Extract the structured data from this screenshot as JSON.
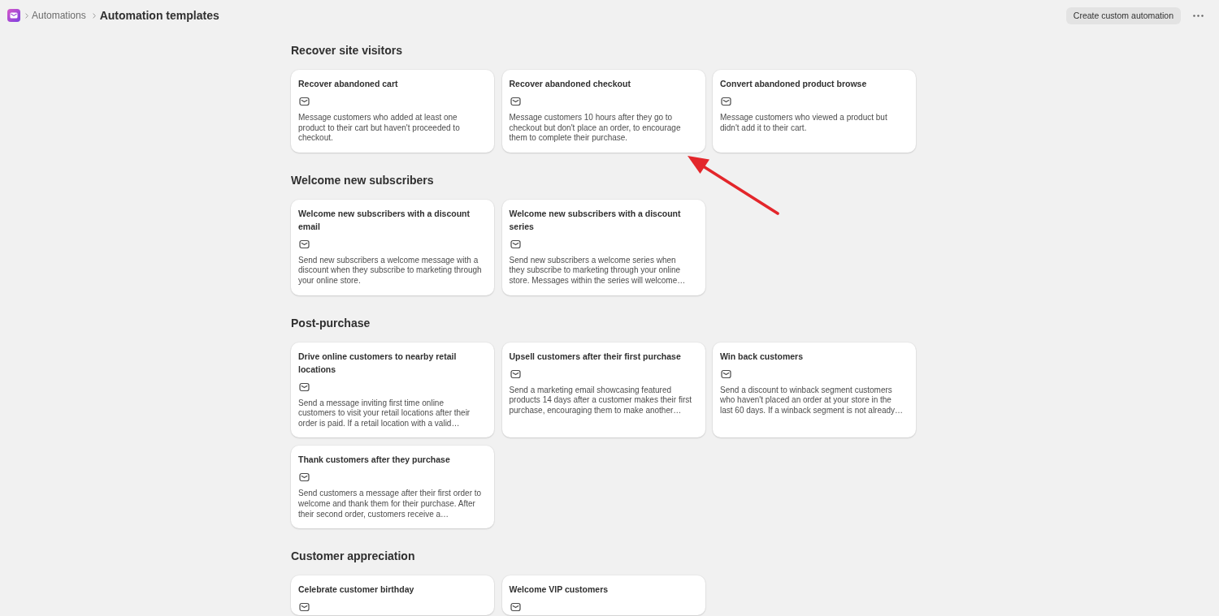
{
  "breadcrumb": {
    "parent": "Automations",
    "title": "Automation templates"
  },
  "header_actions": {
    "primary_button": "Create custom automation"
  },
  "sections": [
    {
      "title": "Recover site visitors",
      "cards": [
        {
          "title": "Recover abandoned cart",
          "description": "Message customers who added at least one product to their cart but haven't proceeded to checkout."
        },
        {
          "title": "Recover abandoned checkout",
          "description": "Message customers 10 hours after they go to checkout but don't place an order, to encourage them to complete their purchase."
        },
        {
          "title": "Convert abandoned product browse",
          "description": "Message customers who viewed a product but didn't add it to their cart."
        }
      ]
    },
    {
      "title": "Welcome new subscribers",
      "cards": [
        {
          "title": "Welcome new subscribers with a discount email",
          "description": "Send new subscribers a welcome message with a discount when they subscribe to marketing through your online store."
        },
        {
          "title": "Welcome new subscribers with a discount series",
          "description": "Send new subscribers a welcome series when they subscribe to marketing through your online store. Messages within the series will welcome…"
        }
      ]
    },
    {
      "title": "Post-purchase",
      "cards": [
        {
          "title": "Drive online customers to nearby retail locations",
          "description": "Send a message inviting first time online customers to visit your retail locations after their order is paid. If a retail location with a valid…"
        },
        {
          "title": "Upsell customers after their first purchase",
          "description": "Send a marketing email showcasing featured products 14 days after a customer makes their first purchase, encouraging them to make another…"
        },
        {
          "title": "Win back customers",
          "description": "Send a discount to winback segment customers who haven't placed an order at your store in the last 60 days. If a winback segment is not already…"
        },
        {
          "title": "Thank customers after they purchase",
          "description": "Send customers a message after their first order to welcome and thank them for their purchase. After their second order, customers receive a…"
        }
      ]
    },
    {
      "title": "Customer appreciation",
      "cards": [
        {
          "title": "Celebrate customer birthday"
        },
        {
          "title": "Welcome VIP customers"
        }
      ]
    }
  ],
  "annotations": [
    {
      "kind": "arrow"
    }
  ]
}
